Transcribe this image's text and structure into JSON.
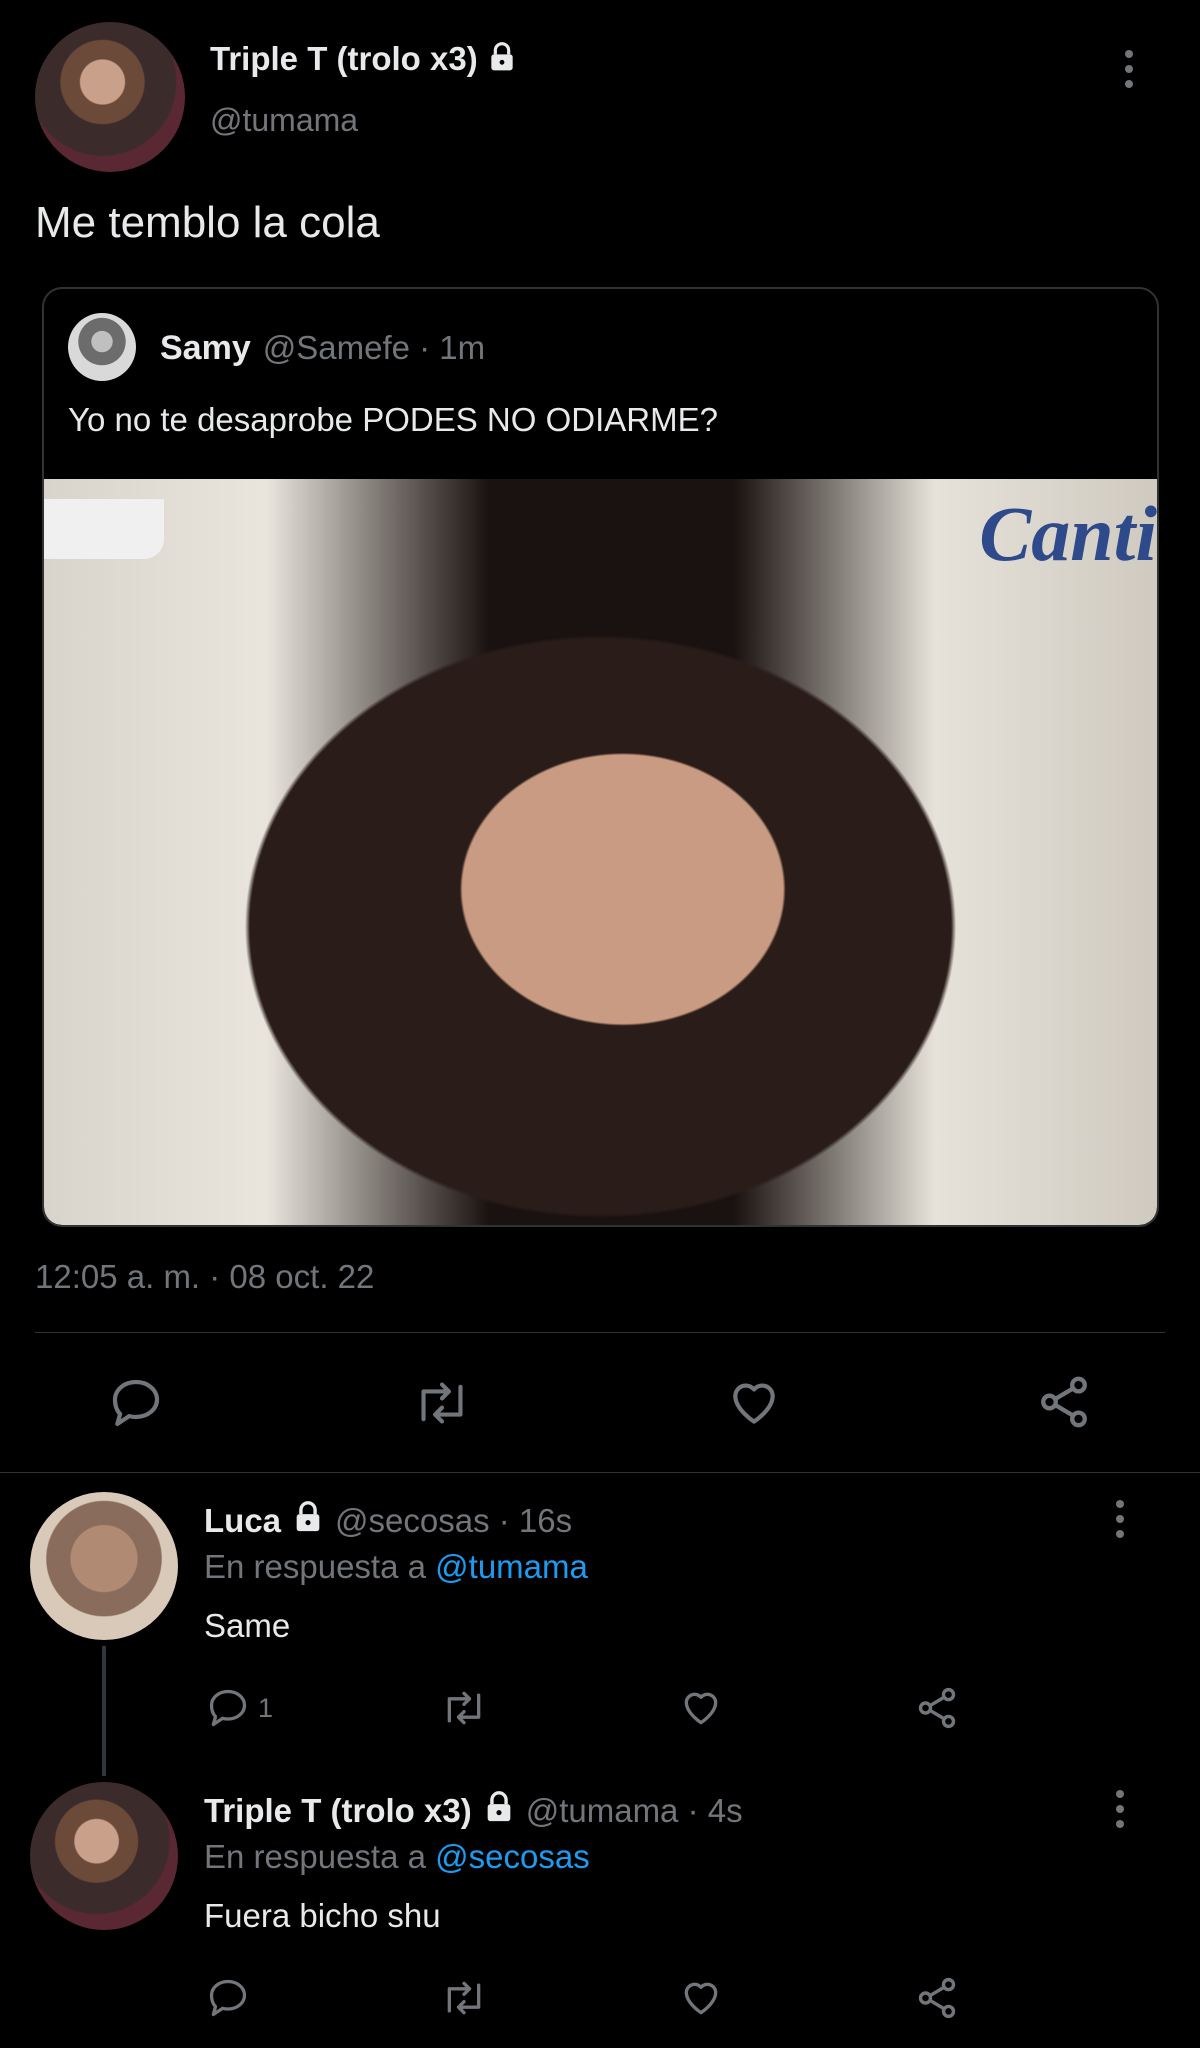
{
  "main_tweet": {
    "display_name": "Triple T (trolo x3)",
    "handle": "@tumama",
    "text": "Me temblo la cola",
    "timestamp": "12:05 a. m. · 08 oct. 22"
  },
  "quoted_tweet": {
    "display_name": "Samy",
    "handle_time": "@Samefe · 1m",
    "text": "Yo no te desaprobe PODES NO ODIARME?",
    "image_text": "Canti"
  },
  "replies": [
    {
      "display_name": "Luca",
      "handle_time": "@secosas · 16s",
      "reply_prefix": "En respuesta a",
      "reply_to": "@tumama",
      "text": "Same",
      "reply_count": "1"
    },
    {
      "display_name": "Triple T (trolo x3)",
      "handle_time": "@tumama · 4s",
      "reply_prefix": "En respuesta a",
      "reply_to": "@secosas",
      "text": "Fuera bicho shu",
      "reply_count": ""
    }
  ],
  "icons": [
    "lock-icon",
    "more-icon",
    "reply-icon",
    "retweet-icon",
    "like-icon",
    "share-icon"
  ],
  "colors": {
    "background": "#000000",
    "link": "#1d9bf0",
    "muted": "#71767b",
    "divider": "#2f3336"
  }
}
